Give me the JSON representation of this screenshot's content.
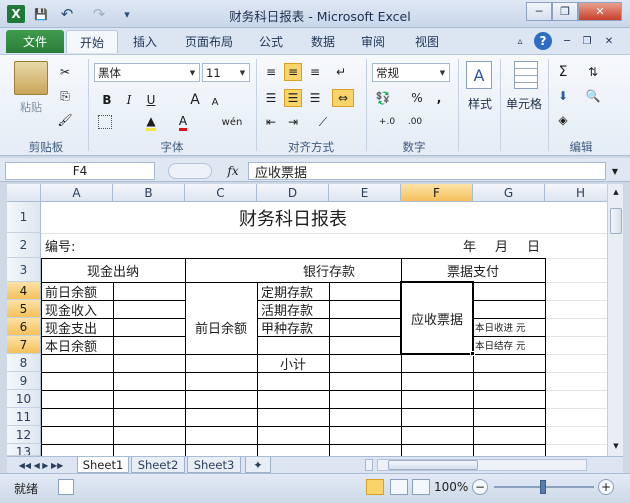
{
  "window": {
    "title": "财务科日报表 - Microsoft Excel"
  },
  "quick_access": {
    "app_icon": "X",
    "save": "💾",
    "undo": "↶",
    "redo": "↷",
    "customize": "▾"
  },
  "window_buttons": {
    "help": "▵",
    "minimize": "─",
    "restore": "❐",
    "close": "✕"
  },
  "tabs": [
    "文件",
    "开始",
    "插入",
    "页面布局",
    "公式",
    "数据",
    "审阅",
    "视图"
  ],
  "ribbon": {
    "clipboard": {
      "label": "剪贴板",
      "paste": "粘贴"
    },
    "font": {
      "label": "字体",
      "name": "黑体",
      "size": "11",
      "bold": "B",
      "italic": "I",
      "underline": "U",
      "grow": "A",
      "shrink": "A",
      "wen": "wén"
    },
    "alignment": {
      "label": "对齐方式"
    },
    "number": {
      "label": "数字",
      "format": "常规",
      "percent": "%",
      "comma": ",",
      "inc_dec": "+.0",
      "dec_dec": ".00"
    },
    "styles": {
      "label": "样式"
    },
    "cells": {
      "label": "单元格"
    },
    "editing": {
      "label": "编辑",
      "sum": "Σ"
    }
  },
  "formula_bar": {
    "name_box": "F4",
    "fx": "fx",
    "value": "应收票据"
  },
  "grid": {
    "columns": [
      "A",
      "B",
      "C",
      "D",
      "E",
      "F",
      "G",
      "H"
    ],
    "rows": [
      "1",
      "2",
      "3",
      "4",
      "5",
      "6",
      "7",
      "8",
      "9",
      "10",
      "11",
      "12",
      "13"
    ],
    "cells": {
      "title": "财务科日报表",
      "number_label": "编号:",
      "year": "年",
      "month": "月",
      "day": "日",
      "cash": "现金出纳",
      "bank": "银行存款",
      "bill": "票据支付",
      "prev_balance": "前日余额",
      "cash_in": "现金收入",
      "cash_out": "现金支出",
      "today_balance": "本日余额",
      "bank_prev": "前日余额",
      "fixed": "定期存款",
      "current": "活期存款",
      "type_a": "甲种存款",
      "subtotal": "小计",
      "receivable": "应收票据",
      "today_received": "本日收进  元",
      "today_balance_g": "本日结存  元"
    }
  },
  "sheets": [
    "Sheet1",
    "Sheet2",
    "Sheet3"
  ],
  "status": {
    "ready": "就绪",
    "zoom": "100%",
    "minus": "−",
    "plus": "+"
  }
}
